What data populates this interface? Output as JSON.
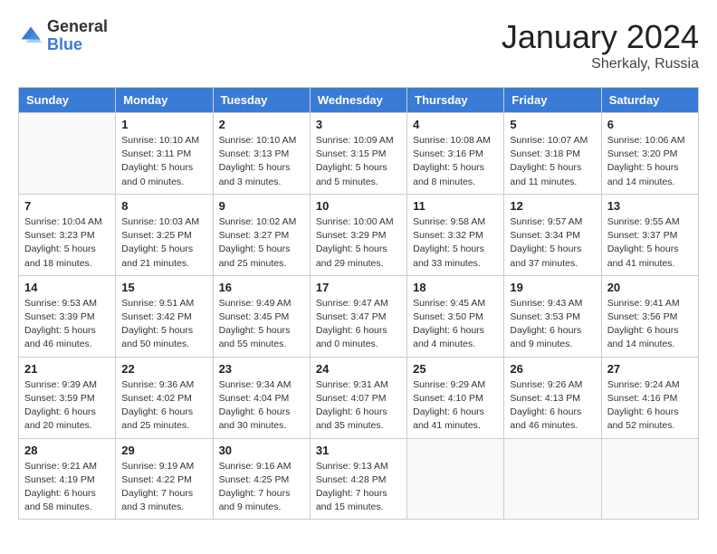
{
  "logo": {
    "general": "General",
    "blue": "Blue"
  },
  "header": {
    "month": "January 2024",
    "location": "Sherkaly, Russia"
  },
  "weekdays": [
    "Sunday",
    "Monday",
    "Tuesday",
    "Wednesday",
    "Thursday",
    "Friday",
    "Saturday"
  ],
  "weeks": [
    [
      {
        "day": "",
        "info": ""
      },
      {
        "day": "1",
        "info": "Sunrise: 10:10 AM\nSunset: 3:11 PM\nDaylight: 5 hours\nand 0 minutes."
      },
      {
        "day": "2",
        "info": "Sunrise: 10:10 AM\nSunset: 3:13 PM\nDaylight: 5 hours\nand 3 minutes."
      },
      {
        "day": "3",
        "info": "Sunrise: 10:09 AM\nSunset: 3:15 PM\nDaylight: 5 hours\nand 5 minutes."
      },
      {
        "day": "4",
        "info": "Sunrise: 10:08 AM\nSunset: 3:16 PM\nDaylight: 5 hours\nand 8 minutes."
      },
      {
        "day": "5",
        "info": "Sunrise: 10:07 AM\nSunset: 3:18 PM\nDaylight: 5 hours\nand 11 minutes."
      },
      {
        "day": "6",
        "info": "Sunrise: 10:06 AM\nSunset: 3:20 PM\nDaylight: 5 hours\nand 14 minutes."
      }
    ],
    [
      {
        "day": "7",
        "info": "Sunrise: 10:04 AM\nSunset: 3:23 PM\nDaylight: 5 hours\nand 18 minutes."
      },
      {
        "day": "8",
        "info": "Sunrise: 10:03 AM\nSunset: 3:25 PM\nDaylight: 5 hours\nand 21 minutes."
      },
      {
        "day": "9",
        "info": "Sunrise: 10:02 AM\nSunset: 3:27 PM\nDaylight: 5 hours\nand 25 minutes."
      },
      {
        "day": "10",
        "info": "Sunrise: 10:00 AM\nSunset: 3:29 PM\nDaylight: 5 hours\nand 29 minutes."
      },
      {
        "day": "11",
        "info": "Sunrise: 9:58 AM\nSunset: 3:32 PM\nDaylight: 5 hours\nand 33 minutes."
      },
      {
        "day": "12",
        "info": "Sunrise: 9:57 AM\nSunset: 3:34 PM\nDaylight: 5 hours\nand 37 minutes."
      },
      {
        "day": "13",
        "info": "Sunrise: 9:55 AM\nSunset: 3:37 PM\nDaylight: 5 hours\nand 41 minutes."
      }
    ],
    [
      {
        "day": "14",
        "info": "Sunrise: 9:53 AM\nSunset: 3:39 PM\nDaylight: 5 hours\nand 46 minutes."
      },
      {
        "day": "15",
        "info": "Sunrise: 9:51 AM\nSunset: 3:42 PM\nDaylight: 5 hours\nand 50 minutes."
      },
      {
        "day": "16",
        "info": "Sunrise: 9:49 AM\nSunset: 3:45 PM\nDaylight: 5 hours\nand 55 minutes."
      },
      {
        "day": "17",
        "info": "Sunrise: 9:47 AM\nSunset: 3:47 PM\nDaylight: 6 hours\nand 0 minutes."
      },
      {
        "day": "18",
        "info": "Sunrise: 9:45 AM\nSunset: 3:50 PM\nDaylight: 6 hours\nand 4 minutes."
      },
      {
        "day": "19",
        "info": "Sunrise: 9:43 AM\nSunset: 3:53 PM\nDaylight: 6 hours\nand 9 minutes."
      },
      {
        "day": "20",
        "info": "Sunrise: 9:41 AM\nSunset: 3:56 PM\nDaylight: 6 hours\nand 14 minutes."
      }
    ],
    [
      {
        "day": "21",
        "info": "Sunrise: 9:39 AM\nSunset: 3:59 PM\nDaylight: 6 hours\nand 20 minutes."
      },
      {
        "day": "22",
        "info": "Sunrise: 9:36 AM\nSunset: 4:02 PM\nDaylight: 6 hours\nand 25 minutes."
      },
      {
        "day": "23",
        "info": "Sunrise: 9:34 AM\nSunset: 4:04 PM\nDaylight: 6 hours\nand 30 minutes."
      },
      {
        "day": "24",
        "info": "Sunrise: 9:31 AM\nSunset: 4:07 PM\nDaylight: 6 hours\nand 35 minutes."
      },
      {
        "day": "25",
        "info": "Sunrise: 9:29 AM\nSunset: 4:10 PM\nDaylight: 6 hours\nand 41 minutes."
      },
      {
        "day": "26",
        "info": "Sunrise: 9:26 AM\nSunset: 4:13 PM\nDaylight: 6 hours\nand 46 minutes."
      },
      {
        "day": "27",
        "info": "Sunrise: 9:24 AM\nSunset: 4:16 PM\nDaylight: 6 hours\nand 52 minutes."
      }
    ],
    [
      {
        "day": "28",
        "info": "Sunrise: 9:21 AM\nSunset: 4:19 PM\nDaylight: 6 hours\nand 58 minutes."
      },
      {
        "day": "29",
        "info": "Sunrise: 9:19 AM\nSunset: 4:22 PM\nDaylight: 7 hours\nand 3 minutes."
      },
      {
        "day": "30",
        "info": "Sunrise: 9:16 AM\nSunset: 4:25 PM\nDaylight: 7 hours\nand 9 minutes."
      },
      {
        "day": "31",
        "info": "Sunrise: 9:13 AM\nSunset: 4:28 PM\nDaylight: 7 hours\nand 15 minutes."
      },
      {
        "day": "",
        "info": ""
      },
      {
        "day": "",
        "info": ""
      },
      {
        "day": "",
        "info": ""
      }
    ]
  ]
}
